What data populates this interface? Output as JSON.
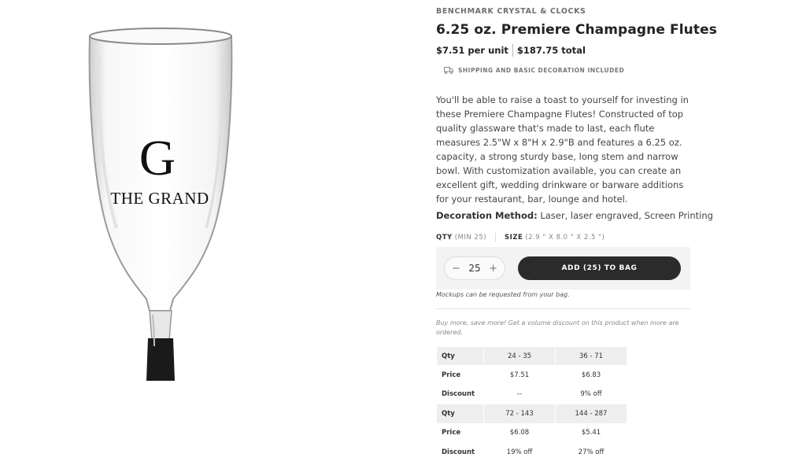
{
  "product": {
    "brand": "BENCHMARK CRYSTAL & CLOCKS",
    "title": "6.25 oz. Premiere Champagne Flutes",
    "unit_price": "$7.51 per unit",
    "total_price": "$187.75 total",
    "shipping_note": "SHIPPING AND BASIC DECORATION INCLUDED",
    "description": "You'll be able to raise a toast to yourself for investing in these Premiere Champagne Flutes! Constructed of top quality glassware that's made to last, each flute measures 2.5\"W x 8\"H x 2.9\"B and features a 6.25 oz. capacity, a strong sturdy base, long stem and narrow bowl. With customization available, you can create an excellent gift, wedding drinkware or barware additions for your restaurant, bar, lounge and hotel.",
    "decoration_label": "Decoration Method:",
    "decoration_value": "Laser, laser engraved, Screen Printing"
  },
  "image": {
    "logo_letter": "G",
    "logo_text": "THE GRAND"
  },
  "options": {
    "qty_label": "QTY",
    "qty_min": "(MIN 25)",
    "size_label": "SIZE",
    "size_value": "(2.9 \" X 8.0 \" X 2.5 \")"
  },
  "cart": {
    "minus": "−",
    "quantity": "25",
    "plus": "+",
    "add_button": "ADD (25) TO BAG",
    "mockups_note": "Mockups can be requested from your bag."
  },
  "volume_note": "Buy more, save more! Get a volume discount on this product when more are ordered.",
  "pricing_table": {
    "rows": [
      {
        "label": "Qty",
        "a": "24 - 35",
        "b": "36 - 71"
      },
      {
        "label": "Price",
        "a": "$7.51",
        "b": "$6.83"
      },
      {
        "label": "Discount",
        "a": "--",
        "b": "9% off"
      },
      {
        "label": "Qty",
        "a": "72 - 143",
        "b": "144 - 287"
      },
      {
        "label": "Price",
        "a": "$6.08",
        "b": "$5.41"
      },
      {
        "label": "Discount",
        "a": "19% off",
        "b": "27% off"
      }
    ]
  },
  "colors": {
    "button_dark": "#2b2b2b",
    "table_shade": "#eeeeee",
    "stem": "#1a1a1a"
  }
}
